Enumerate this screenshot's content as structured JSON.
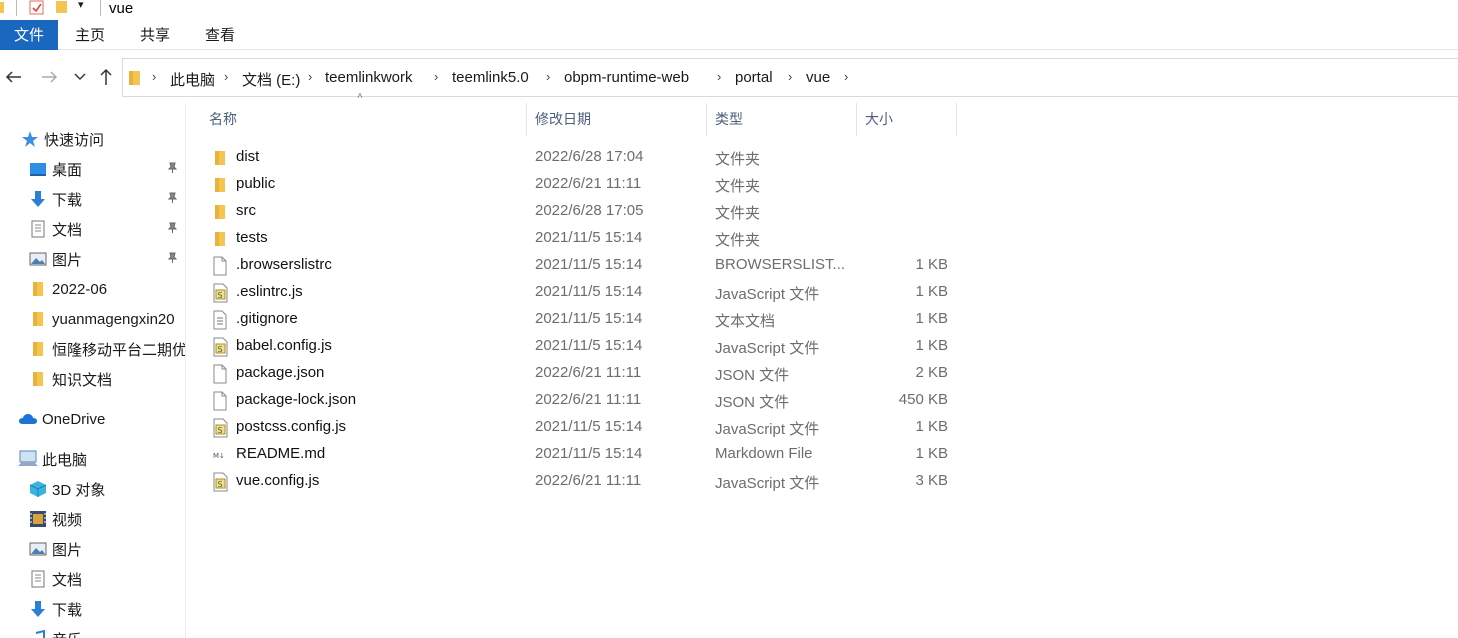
{
  "window": {
    "title": "vue"
  },
  "ribbon": {
    "tabs": [
      "文件",
      "主页",
      "共享",
      "查看"
    ]
  },
  "address": {
    "crumbs": [
      "此电脑",
      "文档 (E:)",
      "teemlinkwork",
      "teemlink5.0",
      "obpm-runtime-web",
      "portal",
      "vue"
    ]
  },
  "sidebar": {
    "items": [
      {
        "label": "快速访问",
        "icon": "star-icon"
      },
      {
        "label": "桌面",
        "icon": "desktop-icon",
        "pinned": true
      },
      {
        "label": "下载",
        "icon": "download-icon",
        "pinned": true
      },
      {
        "label": "文档",
        "icon": "document-icon",
        "pinned": true
      },
      {
        "label": "图片",
        "icon": "picture-icon",
        "pinned": true
      },
      {
        "label": "2022-06",
        "icon": "folder-icon"
      },
      {
        "label": "yuanmagengxin20",
        "icon": "folder-icon"
      },
      {
        "label": "恒隆移动平台二期优",
        "icon": "folder-icon"
      },
      {
        "label": "知识文档",
        "icon": "folder-icon"
      },
      {
        "label": "OneDrive",
        "icon": "cloud-icon"
      },
      {
        "label": "此电脑",
        "icon": "computer-icon"
      },
      {
        "label": "3D 对象",
        "icon": "cube-icon"
      },
      {
        "label": "视频",
        "icon": "video-icon"
      },
      {
        "label": "图片",
        "icon": "picture-icon"
      },
      {
        "label": "文档",
        "icon": "document-icon"
      },
      {
        "label": "下载",
        "icon": "download-icon"
      },
      {
        "label": "音乐",
        "icon": "music-icon"
      }
    ]
  },
  "columns": {
    "name": "名称",
    "date": "修改日期",
    "type": "类型",
    "size": "大小"
  },
  "files": [
    {
      "name": "dist",
      "date": "2022/6/28 17:04",
      "type": "文件夹",
      "size": "",
      "icon": "folder-icon"
    },
    {
      "name": "public",
      "date": "2022/6/21 11:11",
      "type": "文件夹",
      "size": "",
      "icon": "folder-icon"
    },
    {
      "name": "src",
      "date": "2022/6/28 17:05",
      "type": "文件夹",
      "size": "",
      "icon": "folder-icon"
    },
    {
      "name": "tests",
      "date": "2021/11/5 15:14",
      "type": "文件夹",
      "size": "",
      "icon": "folder-icon"
    },
    {
      "name": ".browserslistrc",
      "date": "2021/11/5 15:14",
      "type": "BROWSERSLIST...",
      "size": "1 KB",
      "icon": "blank-file-icon"
    },
    {
      "name": ".eslintrc.js",
      "date": "2021/11/5 15:14",
      "type": "JavaScript 文件",
      "size": "1 KB",
      "icon": "js-file-icon"
    },
    {
      "name": ".gitignore",
      "date": "2021/11/5 15:14",
      "type": "文本文档",
      "size": "1 KB",
      "icon": "text-file-icon"
    },
    {
      "name": "babel.config.js",
      "date": "2021/11/5 15:14",
      "type": "JavaScript 文件",
      "size": "1 KB",
      "icon": "js-file-icon"
    },
    {
      "name": "package.json",
      "date": "2022/6/21 11:11",
      "type": "JSON 文件",
      "size": "2 KB",
      "icon": "blank-file-icon"
    },
    {
      "name": "package-lock.json",
      "date": "2022/6/21 11:11",
      "type": "JSON 文件",
      "size": "450 KB",
      "icon": "blank-file-icon"
    },
    {
      "name": "postcss.config.js",
      "date": "2021/11/5 15:14",
      "type": "JavaScript 文件",
      "size": "1 KB",
      "icon": "js-file-icon"
    },
    {
      "name": "README.md",
      "date": "2021/11/5 15:14",
      "type": "Markdown File",
      "size": "1 KB",
      "icon": "markdown-file-icon"
    },
    {
      "name": "vue.config.js",
      "date": "2022/6/21 11:11",
      "type": "JavaScript 文件",
      "size": "3 KB",
      "icon": "js-file-icon"
    }
  ],
  "colors": {
    "accent": "#1a67c0",
    "folder": "#f5c451",
    "header_text": "#4c607a"
  }
}
